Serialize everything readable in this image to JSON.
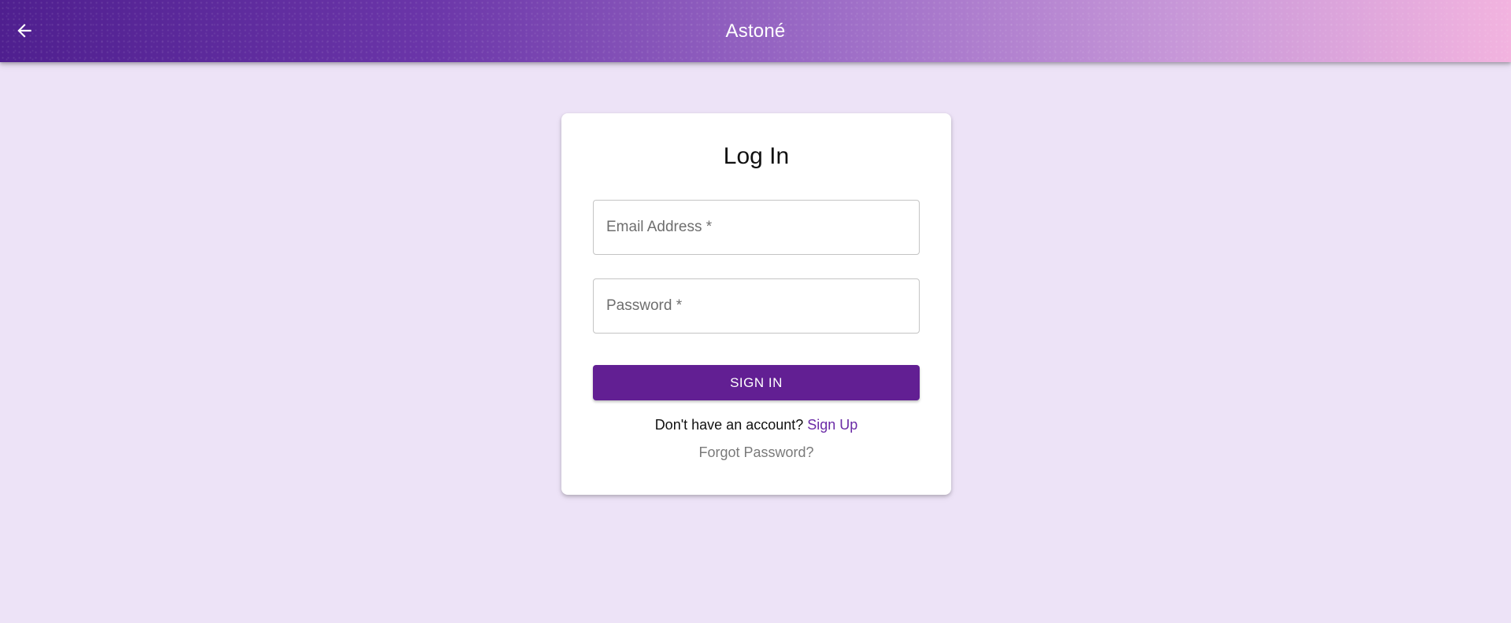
{
  "header": {
    "title": "Astoné",
    "back_icon": "arrow-left-icon",
    "gradient_colors": [
      "#4f1f8f",
      "#6a35a8",
      "#9c6cc6",
      "#c797d8",
      "#f2b3df"
    ]
  },
  "page": {
    "background": "#ede3f7"
  },
  "login": {
    "title": "Log In",
    "email_placeholder": "Email Address *",
    "password_placeholder": "Password *",
    "sign_in_label": "SIGN IN",
    "no_account_text": "Don't have an account?",
    "sign_up_label": "Sign Up",
    "forgot_label": "Forgot Password?",
    "accent_color": "#621f93"
  }
}
